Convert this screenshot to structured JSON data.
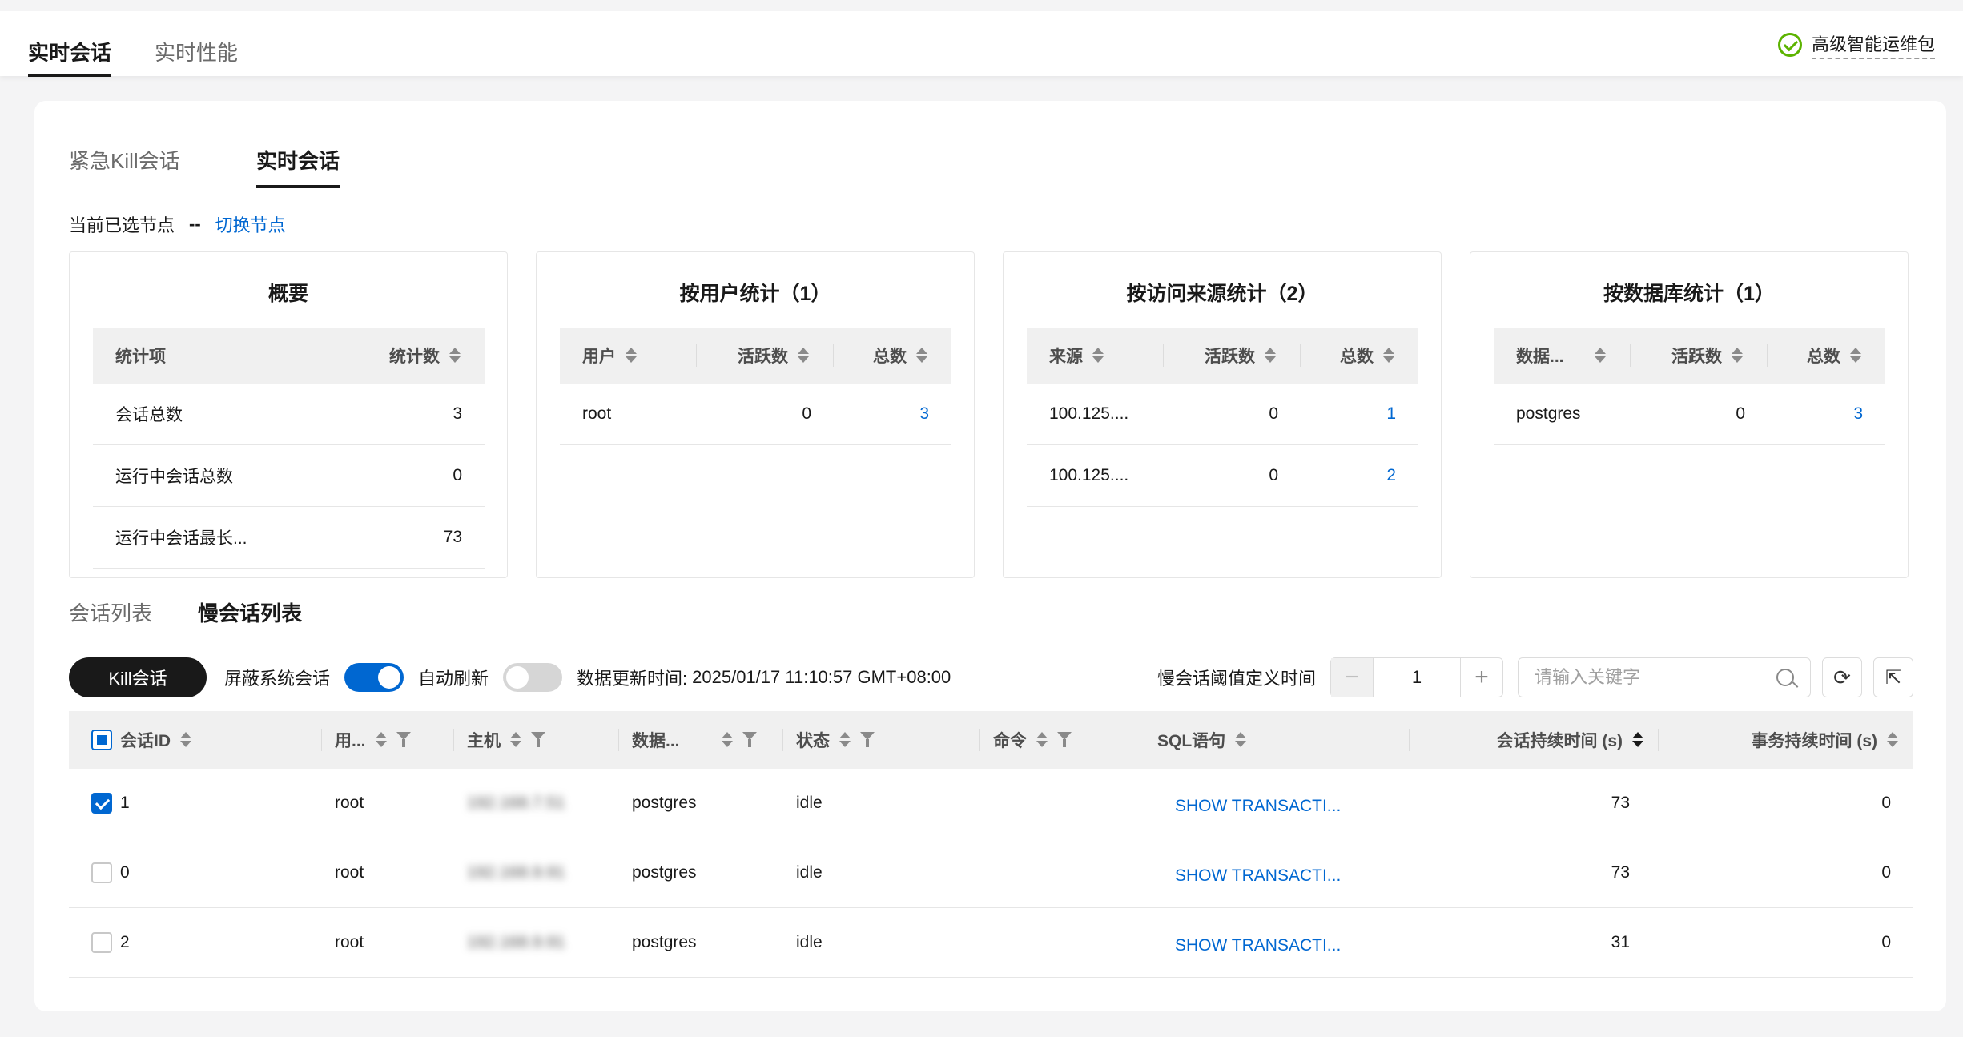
{
  "top_tabs": [
    {
      "label": "实时会话",
      "active": true
    },
    {
      "label": "实时性能",
      "active": false
    }
  ],
  "addon": {
    "label": "高级智能运维包",
    "icon": "check-circle-icon",
    "color": "#5cb300"
  },
  "sub_tabs": [
    {
      "label": "紧急Kill会话",
      "active": false
    },
    {
      "label": "实时会话",
      "active": true
    }
  ],
  "node": {
    "label": "当前已选节点",
    "value": "--",
    "switch_link": "切换节点"
  },
  "cards": {
    "overview": {
      "title": "概要",
      "headers": [
        "统计项",
        "统计数"
      ],
      "rows": [
        {
          "item": "会话总数",
          "count": "3"
        },
        {
          "item": "运行中会话总数",
          "count": "0"
        },
        {
          "item": "运行中会话最长...",
          "count": "73"
        }
      ]
    },
    "by_user": {
      "title": "按用户统计（1）",
      "headers": [
        "用户",
        "活跃数",
        "总数"
      ],
      "rows": [
        {
          "user": "root",
          "active": "0",
          "total": "3"
        }
      ]
    },
    "by_source": {
      "title": "按访问来源统计（2）",
      "headers": [
        "来源",
        "活跃数",
        "总数"
      ],
      "rows": [
        {
          "source": "100.125....",
          "active": "0",
          "total": "1"
        },
        {
          "source": "100.125....",
          "active": "0",
          "total": "2"
        }
      ]
    },
    "by_db": {
      "title": "按数据库统计（1）",
      "headers": [
        "数据...",
        "活跃数",
        "总数"
      ],
      "rows": [
        {
          "db": "postgres",
          "active": "0",
          "total": "3"
        }
      ]
    }
  },
  "list_tabs": [
    {
      "label": "会话列表",
      "active": false
    },
    {
      "label": "慢会话列表",
      "active": true
    }
  ],
  "toolbar": {
    "kill_label": "Kill会话",
    "mask_label": "屏蔽系统会话",
    "mask_on": true,
    "auto_refresh_label": "自动刷新",
    "auto_refresh_on": false,
    "update_time_label": "数据更新时间:",
    "update_time_value": "2025/01/17 11:10:57 GMT+08:00",
    "threshold_label": "慢会话阈值定义时间",
    "threshold_value": "1",
    "search_placeholder": "请输入关键字"
  },
  "grid": {
    "headers": [
      "会话ID",
      "用...",
      "主机",
      "数据...",
      "状态",
      "命令",
      "SQL语句",
      "会话持续时间 (s)",
      "事务持续时间 (s)"
    ],
    "rows": [
      {
        "checked": true,
        "id": "1",
        "user": "root",
        "host": "192.168.7.51",
        "db": "postgres",
        "state": "idle",
        "command": "",
        "sql": "SHOW TRANSACTI...",
        "session_dur": "73",
        "tx_dur": "0"
      },
      {
        "checked": false,
        "id": "0",
        "user": "root",
        "host": "192.168.9.91",
        "db": "postgres",
        "state": "idle",
        "command": "",
        "sql": "SHOW TRANSACTI...",
        "session_dur": "73",
        "tx_dur": "0"
      },
      {
        "checked": false,
        "id": "2",
        "user": "root",
        "host": "192.168.9.91",
        "db": "postgres",
        "state": "idle",
        "command": "",
        "sql": "SHOW TRANSACTI...",
        "session_dur": "31",
        "tx_dur": "0"
      }
    ]
  }
}
